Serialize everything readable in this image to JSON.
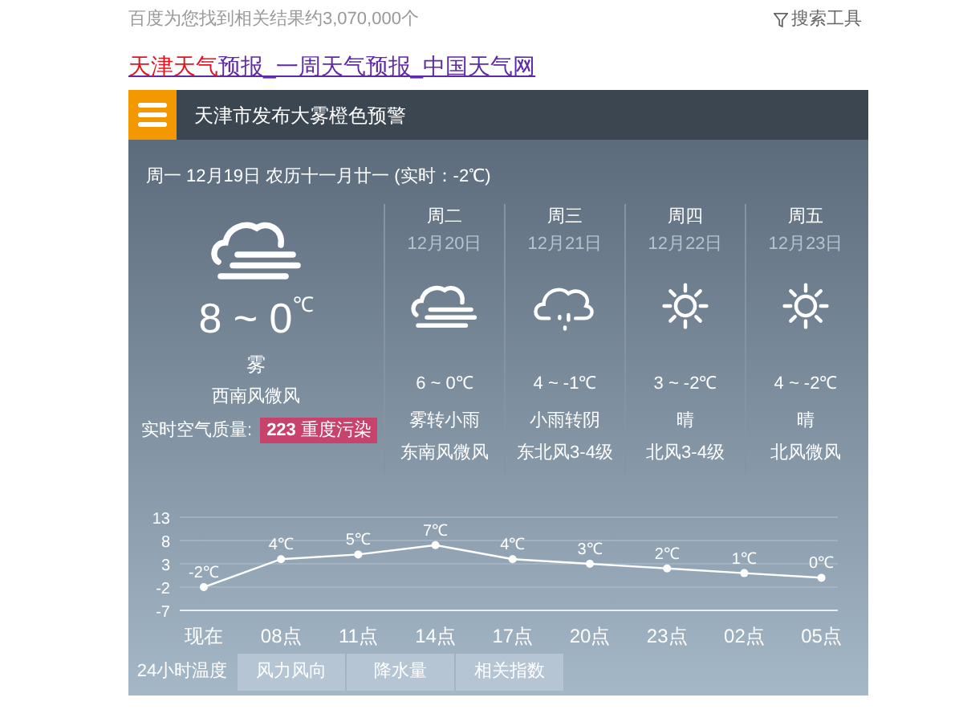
{
  "result_count": "百度为您找到相关结果约3,070,000个",
  "search_tools": "搜索工具",
  "result_title": {
    "highlight": "天津天气",
    "rest": "预报_一周天气预报_中国天气网"
  },
  "alert": "天津市发布大雾橙色预警",
  "date_line": "周一 12月19日 农历十一月廿一 (实时：-2℃)",
  "today": {
    "kind": "fog",
    "temp": "8 ~ 0",
    "unit": "℃",
    "weather": "雾",
    "wind": "西南风微风",
    "aqi_label": "实时空气质量:",
    "aqi_value": "223",
    "aqi_level": "重度污染"
  },
  "days": [
    {
      "weekday": "周二",
      "date": "12月20日",
      "kind": "fog",
      "temp": "6 ~ 0℃",
      "weather": "雾转小雨",
      "wind": "东南风微风"
    },
    {
      "weekday": "周三",
      "date": "12月21日",
      "kind": "rain",
      "temp": "4 ~ -1℃",
      "weather": "小雨转阴",
      "wind": "东北风3-4级"
    },
    {
      "weekday": "周四",
      "date": "12月22日",
      "kind": "sun",
      "temp": "3 ~ -2℃",
      "weather": "晴",
      "wind": "北风3-4级"
    },
    {
      "weekday": "周五",
      "date": "12月23日",
      "kind": "sun",
      "temp": "4 ~ -2℃",
      "weather": "晴",
      "wind": "北风微风"
    }
  ],
  "chart_data": {
    "type": "line",
    "categories": [
      "现在",
      "08点",
      "11点",
      "14点",
      "17点",
      "20点",
      "23点",
      "02点",
      "05点"
    ],
    "series": [
      {
        "color": "#ffffff",
        "marker": true,
        "values": [
          -2,
          4,
          5,
          7,
          4,
          3,
          2,
          1,
          0
        ]
      }
    ],
    "grid": true,
    "ylim": [
      -7,
      13
    ],
    "yticks": [
      13,
      8,
      3,
      -2,
      -7
    ],
    "value_labels": [
      "-2℃",
      "4℃",
      "5℃",
      "7℃",
      "4℃",
      "3℃",
      "2℃",
      "1℃",
      "0℃"
    ]
  },
  "tabs": [
    {
      "label": "24小时温度",
      "selected": true
    },
    {
      "label": "风力风向",
      "selected": false
    },
    {
      "label": "降水量",
      "selected": false
    },
    {
      "label": "相关指数",
      "selected": false
    }
  ]
}
